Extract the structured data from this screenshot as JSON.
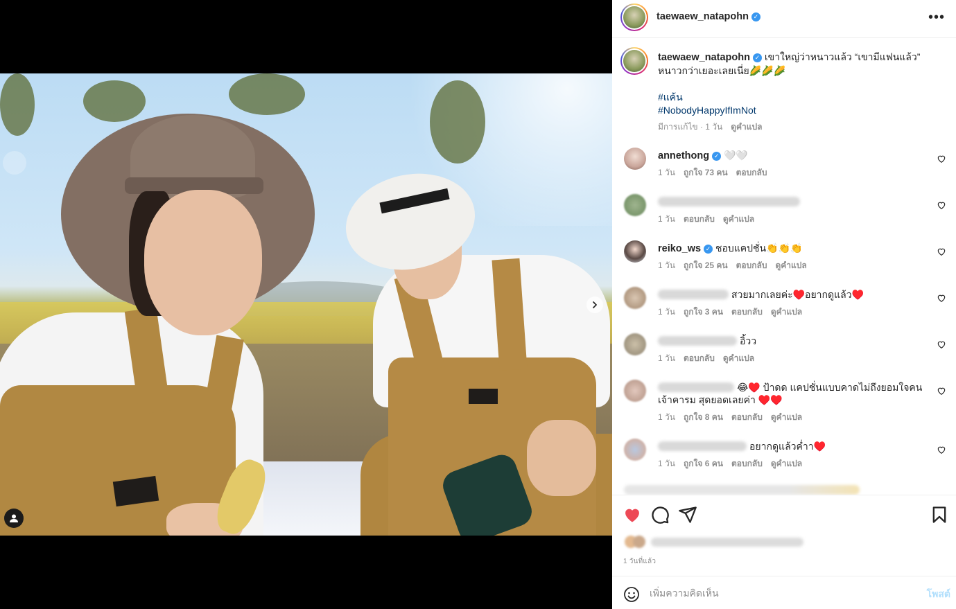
{
  "colors": {
    "accent": "#0095f6",
    "verified": "#3897f0",
    "like_red": "#ed4956",
    "hashtag": "#00376b",
    "muted": "#8e8e8e"
  },
  "media": {
    "type": "photo carousel",
    "next_icon": "chevron-right-icon",
    "tag_icon": "user-tag-icon"
  },
  "post": {
    "author": "taewaew_natapohn",
    "verified": true,
    "caption": "เขาใหญ่ว่าหนาวแล้ว “เขามีแฟนแล้ว” หนาวกว่าเยอะเลยเนี่ย🌽🌽🌽",
    "hashtags": [
      "#แค้น",
      "#NobodyHappyIfImNot"
    ],
    "edited_label": "มีการแก้ไข",
    "age": "1 วัน",
    "translate": "ดูคำแปล"
  },
  "comments": [
    {
      "user": "annethong",
      "verified": true,
      "text": "🤍🤍",
      "age": "1 วัน",
      "likes": "ถูกใจ 73 คน",
      "reply": "ตอบกลับ",
      "translate": "",
      "blurred": false
    },
    {
      "user": "",
      "verified": false,
      "text": "",
      "age": "1 วัน",
      "likes": "",
      "reply": "ตอบกลับ",
      "translate": "ดูคำแปล",
      "blurred": true
    },
    {
      "user": "reiko_ws",
      "verified": true,
      "text": "ชอบแคปชั่น👏👏👏",
      "age": "1 วัน",
      "likes": "ถูกใจ 25 คน",
      "reply": "ตอบกลับ",
      "translate": "ดูคำแปล",
      "blurred": false
    },
    {
      "user": "",
      "verified": false,
      "text": "สวยมากเลยค่ะ♥️อยากดูแล้ว♥️",
      "age": "1 วัน",
      "likes": "ถูกใจ 3 คน",
      "reply": "ตอบกลับ",
      "translate": "ดูคำแปล",
      "blurred": true
    },
    {
      "user": "",
      "verified": false,
      "text": "อิ้วว",
      "age": "1 วัน",
      "likes": "",
      "reply": "ตอบกลับ",
      "translate": "ดูคำแปล",
      "blurred": true
    },
    {
      "user": "",
      "verified": false,
      "text": "😂♥️ ป้าดด แคปชั่นแบบคาดไม่ถึงยอมใจคนเจ้าคารม สุดยอดเลยค่า ♥️♥️",
      "age": "1 วัน",
      "likes": "ถูกใจ 8 คน",
      "reply": "ตอบกลับ",
      "translate": "ดูคำแปล",
      "blurred": true
    },
    {
      "user": "",
      "verified": false,
      "text": "อยากดูแล้วค่ำา♥️",
      "age": "1 วัน",
      "likes": "ถูกใจ 6 คน",
      "reply": "ตอบกลับ",
      "translate": "ดูคำแปล",
      "blurred": true
    }
  ],
  "actions": {
    "like_icon": "heart-filled-icon",
    "comment_icon": "comment-icon",
    "share_icon": "share-icon",
    "save_icon": "bookmark-icon",
    "time_ago": "1 วันที่แล้ว"
  },
  "composer": {
    "emoji_icon": "emoji-icon",
    "placeholder": "เพิ่มความคิดเห็น",
    "post_label": "โพสต์"
  }
}
